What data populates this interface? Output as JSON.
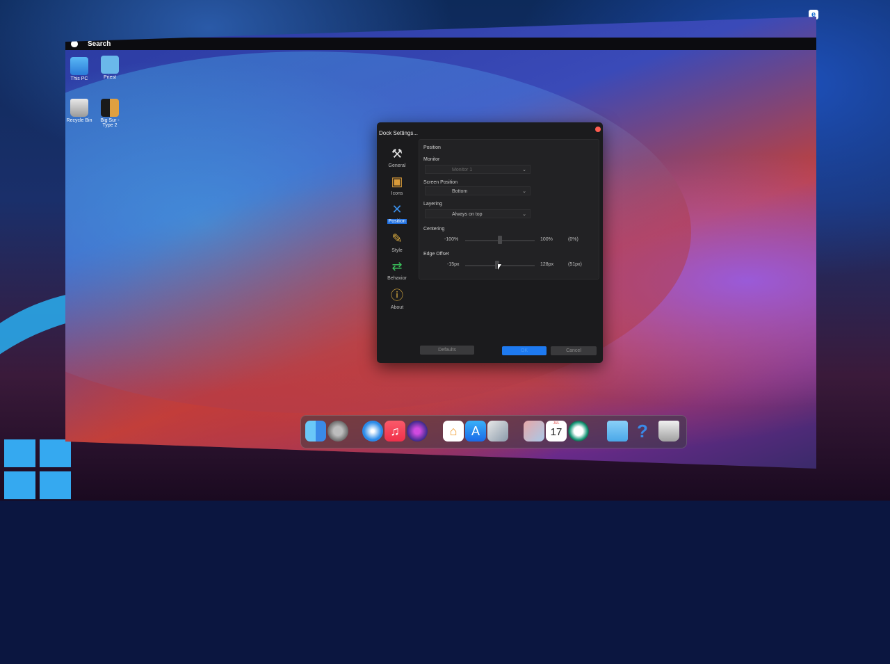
{
  "menubar": {
    "search_label": "Search"
  },
  "desktop_icons": [
    {
      "label": "This PC"
    },
    {
      "label": "Priest"
    },
    {
      "label": "Recycle Bin"
    },
    {
      "label": "Big Sur - Type 2"
    }
  ],
  "dialog": {
    "title": "Dock Settings...",
    "sidebar": [
      {
        "label": "General",
        "icon": "tools-icon"
      },
      {
        "label": "Icons",
        "icon": "box-icon"
      },
      {
        "label": "Position",
        "icon": "arrows-icon",
        "active": true
      },
      {
        "label": "Style",
        "icon": "pencil-icon"
      },
      {
        "label": "Behavior",
        "icon": "exchange-icon"
      },
      {
        "label": "About",
        "icon": "info-icon"
      }
    ],
    "section_title": "Position",
    "monitor": {
      "label": "Monitor",
      "value": "Monitor 1"
    },
    "screen_position": {
      "label": "Screen Position",
      "value": "Bottom"
    },
    "layering": {
      "label": "Layering",
      "value": "Always on top"
    },
    "centering": {
      "label": "Centering",
      "min": "-100%",
      "max": "100%",
      "current": "(0%)",
      "level": 0.5
    },
    "edge_offset": {
      "label": "Edge Offset",
      "min": "-15px",
      "max": "128px",
      "current": "(51px)",
      "level": 0.46
    },
    "buttons": {
      "defaults": "Defaults",
      "ok": "OK",
      "cancel": "Cancel"
    }
  },
  "calendar": {
    "month": "JUL",
    "day": "17"
  },
  "dock_items": [
    "finder-icon",
    "settings-icon",
    "safari-icon",
    "music-icon",
    "siri-icon",
    "home-icon",
    "app-store-icon",
    "preview-icon",
    "launchpad-icon",
    "calendar-icon",
    "time-machine-icon",
    "folder-icon",
    "help-icon",
    "trash-icon"
  ]
}
